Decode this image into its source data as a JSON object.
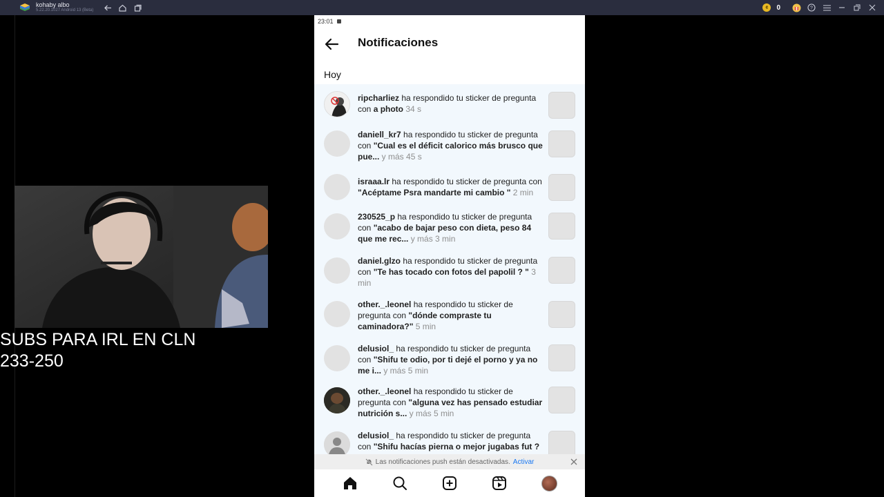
{
  "emulator": {
    "app_name": "kohaby albo",
    "version": "5.22.20.1027 Android 13 (Beta)",
    "coin_count": "0"
  },
  "overlay": {
    "line1": "SUBS PARA IRL EN CLN",
    "line2": "233-250"
  },
  "phone": {
    "status_time": "23:01",
    "header_title": "Notificaciones",
    "section_today": "Hoy",
    "notifications": [
      {
        "user": "ripcharliez",
        "action": " ha respondido tu sticker de pregunta con ",
        "quote": "a photo",
        "time": " 34 s"
      },
      {
        "user": "daniell_kr7",
        "action": " ha respondido tu sticker de pregunta con ",
        "quote": "\"Cual es el déficit calorico más brusco que pue...",
        "time": " y más 45 s"
      },
      {
        "user": "israaa.lr",
        "action": " ha respondido tu sticker de pregunta con ",
        "quote": "\"Acéptame Psra mandarte mi cambio \"",
        "time": " 2 min"
      },
      {
        "user": "230525_p",
        "action": " ha respondido tu sticker de pregunta con ",
        "quote": "\"acabo de bajar peso con dieta, peso 84 que me rec...",
        "time": " y más 3 min"
      },
      {
        "user": "daniel.glzo",
        "action": " ha respondido tu sticker de pregunta con ",
        "quote": "\"Te has tocado con fotos del papolil ? \"",
        "time": " 3 min"
      },
      {
        "user": "other._.leonel",
        "action": " ha respondido tu sticker de pregunta con ",
        "quote": "\"dónde compraste tu caminadora?\"",
        "time": " 5 min"
      },
      {
        "user": "delusiol_",
        "action": " ha respondido tu sticker de pregunta con ",
        "quote": "\"Shifu te odio, por ti dejé el porno y ya no me i...",
        "time": " y más 5 min"
      },
      {
        "user": "other._.leonel",
        "action": " ha respondido tu sticker de pregunta con ",
        "quote": "\"alguna vez has pensado estudiar nutrición s...",
        "time": " y más 5 min"
      },
      {
        "user": "delusiol_",
        "action": " ha respondido tu sticker de pregunta con ",
        "quote": "\"Shifu hacías pierna o mejor jugabas fut ? \"",
        "time": ""
      }
    ],
    "push_banner": {
      "text": "Las notificaciones push están desactivadas.",
      "action": "Activar"
    },
    "nav_icons": [
      "home-icon",
      "search-icon",
      "create-icon",
      "reels-icon",
      "profile-avatar"
    ]
  },
  "colors": {
    "list_bg": "#f2f8fd",
    "link_blue": "#1877f2",
    "titlebar_bg": "#2a2d3e"
  }
}
